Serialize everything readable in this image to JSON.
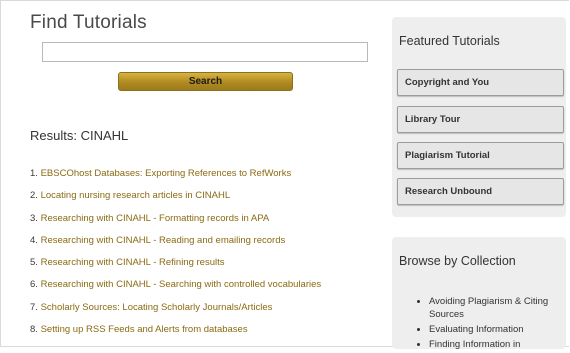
{
  "main": {
    "title": "Find Tutorials",
    "search": {
      "value": "",
      "placeholder": "",
      "button_label": "Search"
    },
    "results_heading": "Results: CINAHL",
    "results": [
      {
        "num": "1.",
        "label": "EBSCOhost Databases: Exporting References to RefWorks"
      },
      {
        "num": "2.",
        "label": "Locating nursing research articles in CINAHL"
      },
      {
        "num": "3.",
        "label": "Researching with CINAHL - Formatting records in APA"
      },
      {
        "num": "4.",
        "label": "Researching with CINAHL - Reading and emailing records"
      },
      {
        "num": "5.",
        "label": "Researching with CINAHL - Refining results"
      },
      {
        "num": "6.",
        "label": "Researching with CINAHL - Searching with controlled vocabularies"
      },
      {
        "num": "7.",
        "label": "Scholarly Sources: Locating Scholarly Journals/Articles"
      },
      {
        "num": "8.",
        "label": "Setting up RSS Feeds and Alerts from databases"
      }
    ]
  },
  "featured": {
    "heading": "Featured Tutorials",
    "buttons": [
      {
        "label": "Copyright and You"
      },
      {
        "label": "Library Tour"
      },
      {
        "label": "Plagiarism Tutorial"
      },
      {
        "label": "Research Unbound"
      }
    ]
  },
  "browse": {
    "heading": "Browse by Collection",
    "items": [
      {
        "label": "Avoiding Plagiarism & Citing Sources"
      },
      {
        "label": "Evaluating Information"
      },
      {
        "label": "Finding Information in"
      }
    ]
  },
  "colors": {
    "link": "#8a6a12",
    "button_gold": "#b08a22",
    "panel_bg": "#eeeeee"
  }
}
